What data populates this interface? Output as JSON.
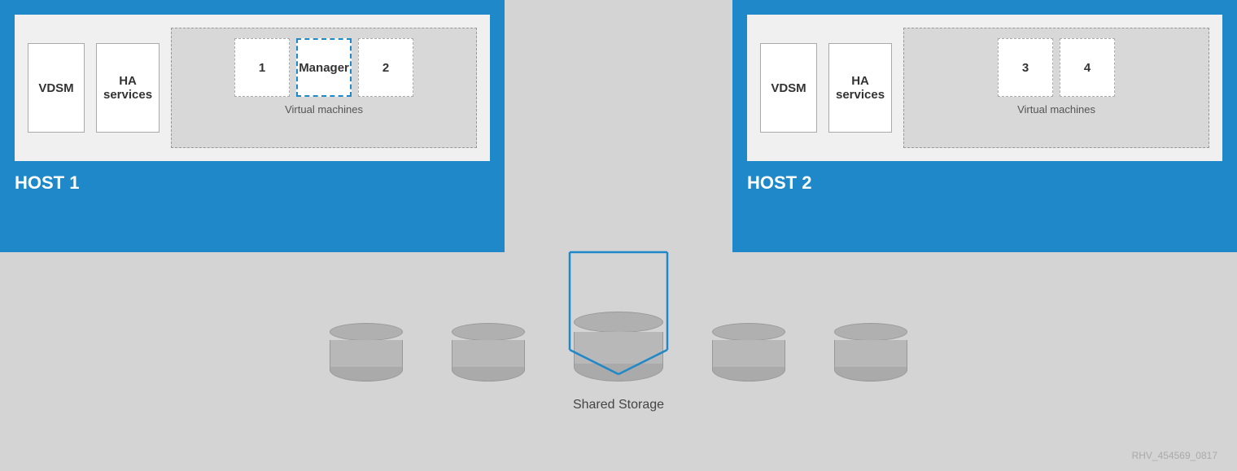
{
  "host1": {
    "label": "HOST 1",
    "vdsm": "VDSM",
    "ha_services": "HA\nservices",
    "vm_group_label": "Virtual machines",
    "vm1": "1",
    "vm_manager": "Manager",
    "vm2": "2"
  },
  "host2": {
    "label": "HOST 2",
    "vdsm": "VDSM",
    "ha_services": "HA\nservices",
    "vm_group_label": "Virtual machines",
    "vm3": "3",
    "vm4": "4"
  },
  "storage": {
    "shared_storage_label": "Shared Storage",
    "watermark": "RHV_454569_0817"
  }
}
